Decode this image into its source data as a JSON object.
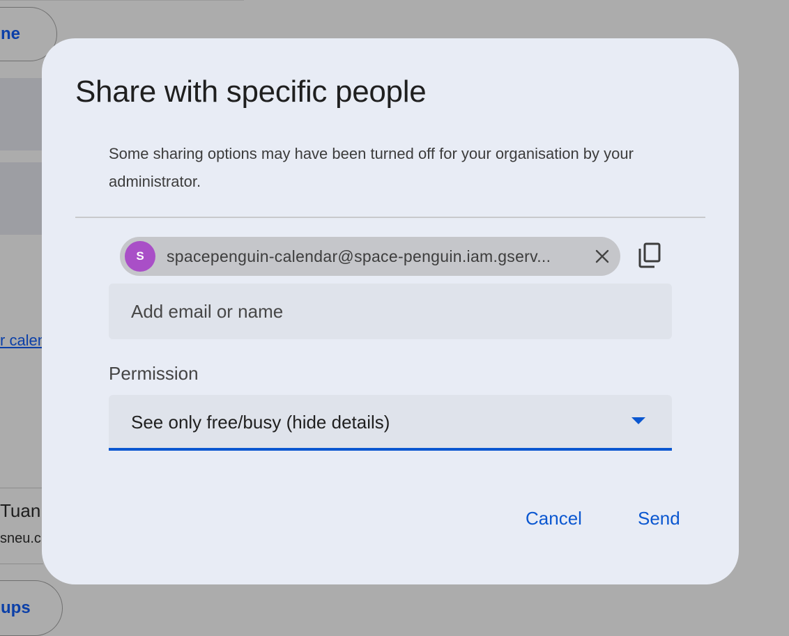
{
  "background": {
    "top_pill_text": "ne",
    "link_text": "r calen",
    "person_name": "Tuan",
    "person_email_fragment": "sneu.c",
    "bottom_pill_text": "ups"
  },
  "dialog": {
    "title": "Share with specific people",
    "notice": "Some sharing options may have been turned off for your organisation by your administrator.",
    "chip": {
      "avatar_letter": "S",
      "email": "spacepenguin-calendar@space-penguin.iam.gserv...",
      "remove_icon": "close-icon"
    },
    "copy_icon": "copy-icon",
    "email_input": {
      "placeholder": "Add email or name",
      "value": ""
    },
    "permission": {
      "label": "Permission",
      "selected": "See only free/busy (hide details)",
      "dropdown_icon": "caret-down-icon"
    },
    "actions": {
      "cancel_label": "Cancel",
      "send_label": "Send"
    }
  },
  "colors": {
    "accent": "#0b57d0",
    "avatar": "#a94fc7",
    "dialog_bg": "#e8ecf5",
    "scrim": "#acacac"
  }
}
